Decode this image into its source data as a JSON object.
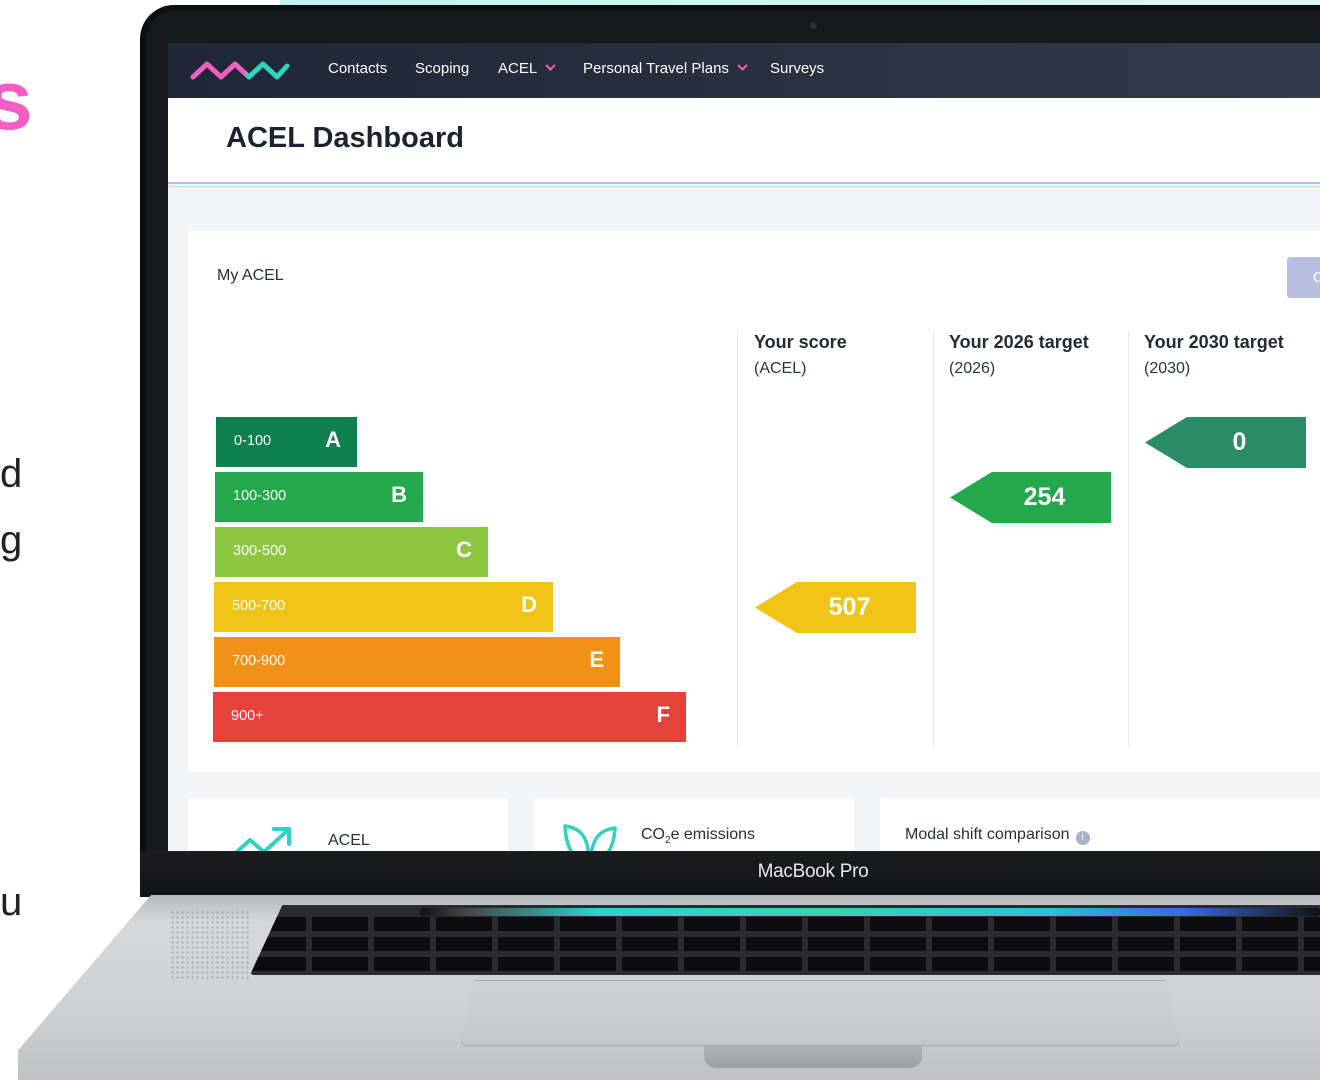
{
  "device": {
    "model_label": "MacBook Pro"
  },
  "background_text": {
    "heading_fragment": "s",
    "line1_fragment": "d",
    "line2_fragment": "g",
    "line3_fragment": "u"
  },
  "nav": {
    "items": [
      {
        "label": "Contacts",
        "dropdown": false
      },
      {
        "label": "Scoping",
        "dropdown": false
      },
      {
        "label": "ACEL",
        "dropdown": true
      },
      {
        "label": "Personal Travel Plans",
        "dropdown": true
      },
      {
        "label": "Surveys",
        "dropdown": false
      }
    ],
    "logo_colors": [
      "#f25ec1",
      "#2fd3c0"
    ]
  },
  "page": {
    "title": "ACEL Dashboard"
  },
  "acel_card": {
    "label": "My ACEL",
    "button_label_fragment": "C",
    "bands": [
      {
        "range": "0-100",
        "grade": "A",
        "color": "#0e7f4f"
      },
      {
        "range": "100-300",
        "grade": "B",
        "color": "#23a84c"
      },
      {
        "range": "300-500",
        "grade": "C",
        "color": "#8dc63f"
      },
      {
        "range": "500-700",
        "grade": "D",
        "color": "#f0c417"
      },
      {
        "range": "700-900",
        "grade": "E",
        "color": "#f19118"
      },
      {
        "range": "900+",
        "grade": "F",
        "color": "#e5423a"
      }
    ],
    "columns": [
      {
        "heading": "Your score",
        "sub": "(ACEL)",
        "value": "507",
        "grade": "D",
        "color": "#f0c417"
      },
      {
        "heading": "Your 2026 target",
        "sub": "(2026)",
        "value": "254",
        "grade": "B",
        "color": "#23a84c"
      },
      {
        "heading": "Your 2030 target",
        "sub": "(2030)",
        "value": "0",
        "grade": "A",
        "color": "#2a8c66"
      }
    ]
  },
  "summary_cards": [
    {
      "label": "ACEL",
      "icon": "trend-up-icon",
      "color": "#2fd3c0"
    },
    {
      "label_pre": "CO",
      "label_sub": "2",
      "label_post": "e emissions",
      "icon": "leaf-icon",
      "color": "#2fd3c0"
    },
    {
      "label": "Modal shift comparison",
      "icon": "info-icon"
    }
  ]
}
